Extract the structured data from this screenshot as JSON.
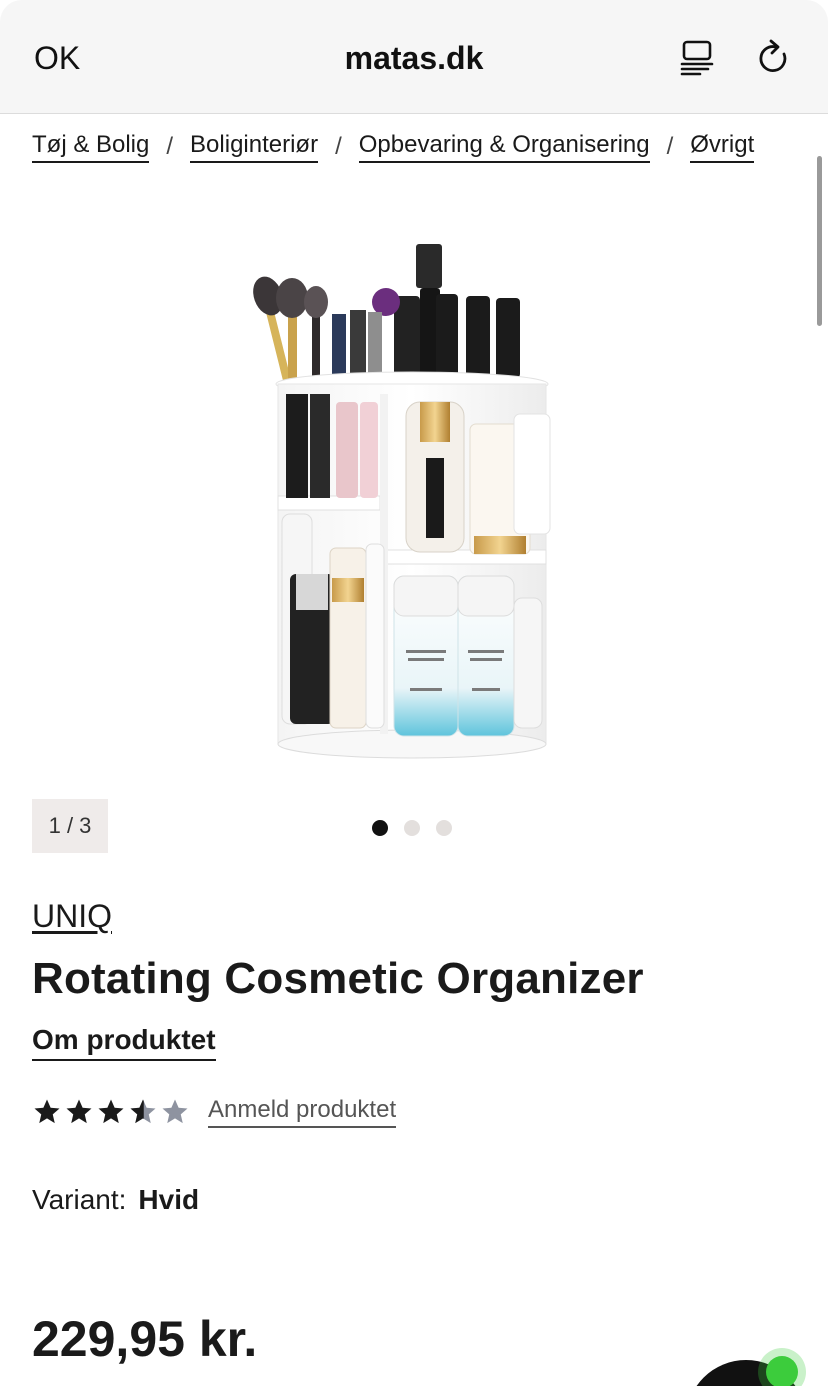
{
  "browser": {
    "done_label": "OK",
    "domain": "matas.dk",
    "reader_icon": "reader-view-icon",
    "reload_icon": "reload-icon"
  },
  "breadcrumb": {
    "items": [
      "Tøj & Bolig",
      "Boliginteriør",
      "Opbevaring & Organisering",
      "Øvrigt"
    ],
    "separator": "/"
  },
  "gallery": {
    "counter": "1 / 3",
    "current": 1,
    "total": 3
  },
  "product": {
    "brand": "UNIQ",
    "title": "Rotating Cosmetic Organizer",
    "about_label": "Om produktet",
    "rating": 3.5,
    "rating_max": 5,
    "review_label": "Anmeld produktet",
    "variant_label": "Variant:",
    "variant_value": "Hvid",
    "price": "229,95 kr."
  },
  "colors": {
    "text": "#1a1a1a",
    "counter_bg": "#efebea",
    "dot_inactive": "#e3dfdd",
    "online": "#3ccc3c"
  }
}
